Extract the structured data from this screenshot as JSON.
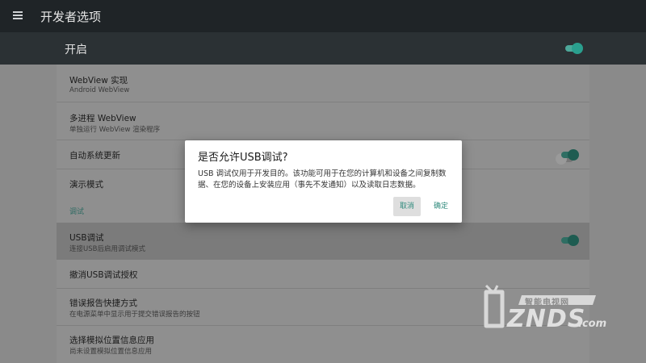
{
  "app": {
    "title": "开发者选项"
  },
  "master": {
    "label": "开启",
    "enabled": true
  },
  "rows": {
    "webview": {
      "title": "WebView 实现",
      "sub": "Android WebView"
    },
    "multiprocess": {
      "title": "多进程 WebView",
      "sub": "单独运行 WebView 渲染程序",
      "enabled": false
    },
    "autoupdate": {
      "title": "自动系统更新",
      "enabled": true
    },
    "demo": {
      "title": "演示模式"
    },
    "section_debug": "调试",
    "usb": {
      "title": "USB调试",
      "sub": "连接USB后启用调试模式",
      "enabled": true
    },
    "revoke": {
      "title": "撤消USB调试授权"
    },
    "bugreport": {
      "title": "错误报告快捷方式",
      "sub": "在电源菜单中显示用于提交错误报告的按钮"
    },
    "mocklocation": {
      "title": "选择模拟位置信息应用",
      "sub": "尚未设置模拟位置信息应用"
    }
  },
  "dialog": {
    "title": "是否允许USB调试?",
    "message": "USB 调试仅用于开发目的。该功能可用于在您的计算机和设备之间复制数据、在您的设备上安装应用（事先不发通知）以及读取日志数据。",
    "cancel": "取消",
    "ok": "确定"
  },
  "watermark": {
    "brand": "ZNDS",
    "domain": ".com",
    "slogan": "智能电视网"
  },
  "colors": {
    "accent": "#2f8a7c",
    "appbar": "#1f2427",
    "dim": "#8a8a8a"
  }
}
